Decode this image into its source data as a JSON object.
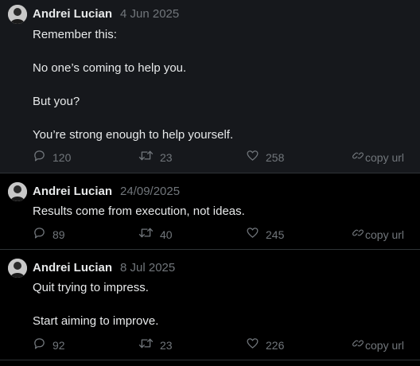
{
  "posts": [
    {
      "author": "Andrei Lucian",
      "date": "4 Jun 2025",
      "paragraphs": [
        "Remember this:",
        "No one’s coming to help you.",
        "But you?",
        "You’re strong enough to help yourself."
      ],
      "replies": "120",
      "retweets": "23",
      "likes": "258",
      "copy_label": "copy url"
    },
    {
      "author": "Andrei Lucian",
      "date": "24/09/2025",
      "paragraphs": [
        "Results come from execution, not ideas."
      ],
      "replies": "89",
      "retweets": "40",
      "likes": "245",
      "copy_label": "copy url"
    },
    {
      "author": "Andrei Lucian",
      "date": "8 Jul 2025",
      "paragraphs": [
        "Quit trying to impress.",
        "Start aiming to improve."
      ],
      "replies": "92",
      "retweets": "23",
      "likes": "226",
      "copy_label": "copy url"
    }
  ],
  "icons": {
    "reply": "reply-icon",
    "retweet": "retweet-icon",
    "like": "heart-icon",
    "copy": "link-icon",
    "avatar": "avatar"
  },
  "colors": {
    "background": "#000000",
    "highlight_background": "#16181c",
    "text": "#e7e9ea",
    "muted": "#71767b",
    "divider": "#2f3336"
  }
}
